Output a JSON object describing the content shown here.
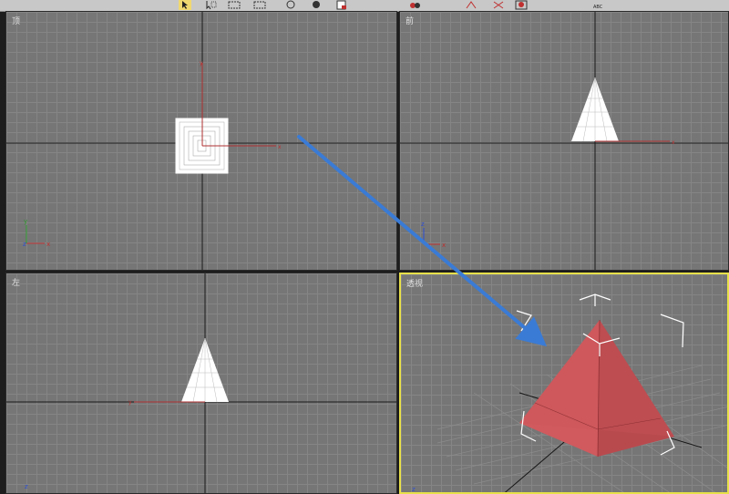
{
  "toolbar": {
    "icons": [
      "select-arrow-icon",
      "select-region-icon",
      "window-crossing-icon",
      "snap-icon",
      "angle-snap-icon",
      "mirror-icon",
      "align-icon",
      "layer-icon",
      "abc-text-icon"
    ],
    "abc_label": "ABC"
  },
  "viewports": {
    "top": {
      "label": "顶"
    },
    "front": {
      "label": "前"
    },
    "left": {
      "label": "左"
    },
    "perspective": {
      "label": "透视"
    }
  },
  "axes": {
    "x": "x",
    "y": "y",
    "z": "z"
  },
  "colors": {
    "grid_bg": "#767676",
    "grid_line": "#858585",
    "active_border": "#e8e04a",
    "pyramid_fill": "#c9565a",
    "annotation_arrow": "#3a7bd5",
    "axis_x": "#c03030",
    "axis_y": "#2f9a2f",
    "axis_z": "#2f4fd0"
  }
}
